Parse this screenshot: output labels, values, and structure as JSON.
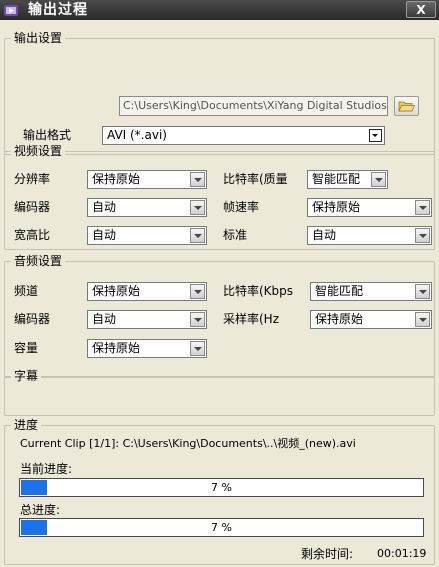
{
  "window": {
    "title": "输出过程",
    "close_label": "X"
  },
  "output": {
    "group_title": "输出设置",
    "path": "C:\\Users\\King\\Documents\\XiYang Digital Studios\\XiYang",
    "format_label": "输出格式",
    "format_value": "AVI  (*.avi)"
  },
  "video": {
    "group_title": "视频设置",
    "resolution_label": "分辨率",
    "resolution_value": "保持原始",
    "bitrate_label": "比特率(质量",
    "bitrate_value": "智能匹配",
    "codec_label": "编码器",
    "codec_value": "自动",
    "framerate_label": "帧速率",
    "framerate_value": "保持原始",
    "aspect_label": "宽高比",
    "aspect_value": "自动",
    "standard_label": "标准",
    "standard_value": "自动"
  },
  "audio": {
    "group_title": "音频设置",
    "channel_label": "频道",
    "channel_value": "保持原始",
    "bitrate_label": "比特率(Kbps",
    "bitrate_value": "智能匹配",
    "codec_label": "编码器",
    "codec_value": "自动",
    "samplerate_label": "采样率(Hz",
    "samplerate_value": "保持原始",
    "volume_label": "容量",
    "volume_value": "保持原始"
  },
  "subtitle": {
    "group_title": "字幕"
  },
  "progress": {
    "group_title": "进度",
    "current_clip": "Current Clip [1/1]: C:\\Users\\King\\Documents\\..\\视频_(new).avi",
    "current_label": "当前进度:",
    "current_percent": 7,
    "current_text": "7 %",
    "total_label": "总进度:",
    "total_percent": 7,
    "total_text": "7 %",
    "remaining_label": "剩余时间:",
    "remaining_value": "00:01:19"
  },
  "colors": {
    "progress_fill": "#1a73e8",
    "titlebar": "#333333",
    "background": "#ece9d8"
  },
  "icons": {
    "app": "app-icon",
    "folder": "folder-open-icon",
    "dropdown": "chevron-down-icon"
  }
}
